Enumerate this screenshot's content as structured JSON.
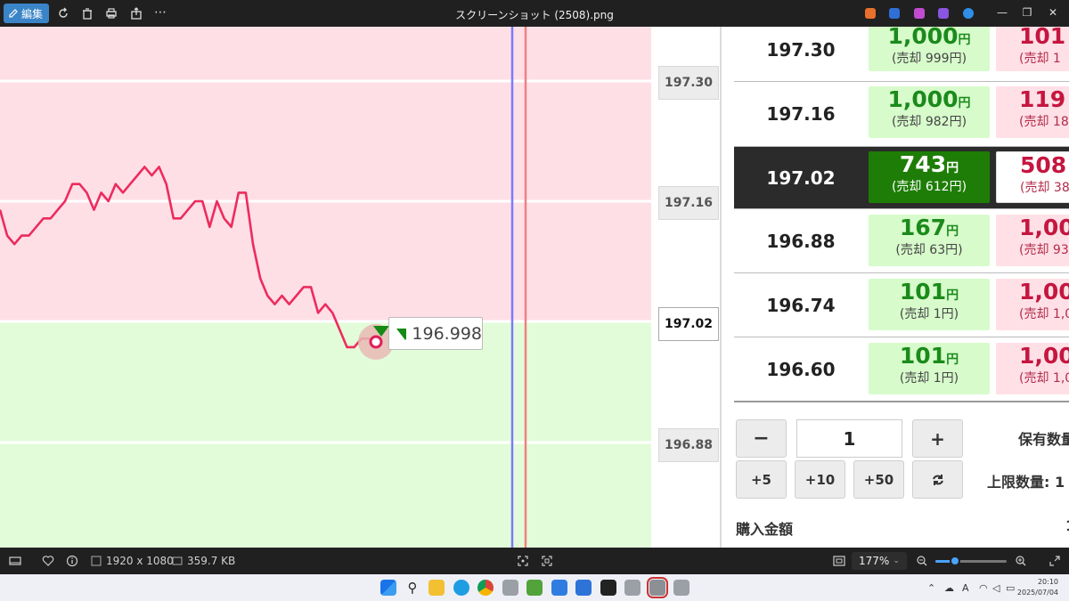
{
  "titlebar": {
    "edit_label": "編集",
    "window_title": "スクリーンショット (2508).png"
  },
  "chart": {
    "y_axis_labels": [
      "197.30",
      "197.16",
      "197.02",
      "196.88"
    ],
    "current_price_label": "197.02",
    "marker_value": "196.998",
    "marker_icon": "down-triangle-icon",
    "zone_colors": {
      "upper": "#ffdfe6",
      "lower": "#e2fcd9",
      "line": "#ec2c5e",
      "blue_line": "#7b7bff",
      "red_line": "#f08080"
    }
  },
  "chart_data": {
    "type": "line",
    "series": [
      {
        "values": [
          197.15,
          197.12,
          197.11,
          197.12,
          197.12,
          197.13,
          197.14,
          197.14,
          197.15,
          197.16,
          197.18,
          197.18,
          197.17,
          197.15,
          197.17,
          197.16,
          197.18,
          197.17,
          197.18,
          197.19,
          197.2,
          197.19,
          197.2,
          197.18,
          197.14,
          197.14,
          197.15,
          197.16,
          197.16,
          197.13,
          197.16,
          197.14,
          197.13,
          197.17,
          197.17,
          197.11,
          197.07,
          197.05,
          197.04,
          197.05,
          197.04,
          197.05,
          197.06,
          197.06,
          197.03,
          197.04,
          197.03,
          197.01,
          196.99,
          196.99,
          197.0,
          197.0,
          196.998
        ]
      }
    ]
  },
  "order_table": {
    "rows": [
      {
        "price": "197.30",
        "buy_amount": "1,000",
        "buy_unit": "円",
        "buy_sub": "(売却 999円)",
        "sell_amount": "101",
        "sell_sub": "(売却 1"
      },
      {
        "price": "197.16",
        "buy_amount": "1,000",
        "buy_unit": "円",
        "buy_sub": "(売却 982円)",
        "sell_amount": "119",
        "sell_sub": "(売却 18"
      },
      {
        "price": "197.02",
        "buy_amount": "743",
        "buy_unit": "円",
        "buy_sub": "(売却 612円)",
        "sell_amount": "508",
        "sell_sub": "(売却 38"
      },
      {
        "price": "196.88",
        "buy_amount": "167",
        "buy_unit": "円",
        "buy_sub": "(売却 63円)",
        "sell_amount": "1,00",
        "sell_sub": "(売却 93"
      },
      {
        "price": "196.74",
        "buy_amount": "101",
        "buy_unit": "円",
        "buy_sub": "(売却 1円)",
        "sell_amount": "1,00",
        "sell_sub": "(売却 1,00"
      },
      {
        "price": "196.60",
        "buy_amount": "101",
        "buy_unit": "円",
        "buy_sub": "(売却 1円)",
        "sell_amount": "1,00",
        "sell_sub": "(売却 1,00"
      }
    ],
    "highlight_row": 2
  },
  "controls": {
    "minus": "−",
    "quantity": "1",
    "plus": "+",
    "plus5": "+5",
    "plus10": "+10",
    "plus50": "+50",
    "holding_label": "保有数量",
    "limit_label": "上限数量: 1",
    "purchase_label": "購入金額",
    "purchase_value_partial": "1"
  },
  "statusbar": {
    "dimensions": "1920 x 1080",
    "filesize": "359.7 KB",
    "zoom": "177%",
    "zoom_level": 0.27
  },
  "taskbar": {
    "time": "20:10",
    "date": "2025/07/04",
    "ime": "A"
  }
}
